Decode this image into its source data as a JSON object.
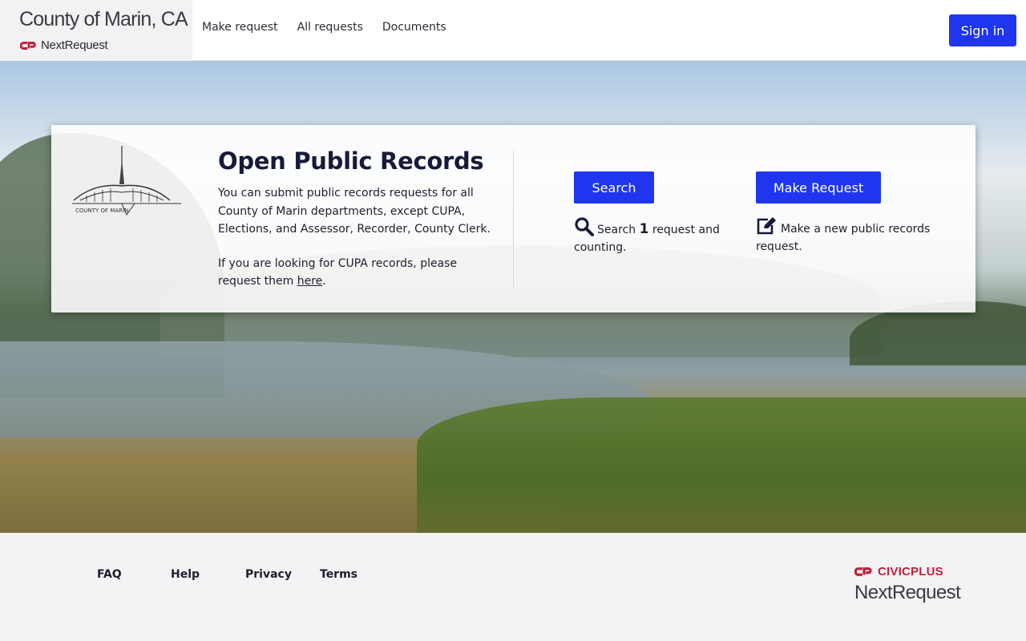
{
  "header": {
    "org_title": "County of Marin, CA",
    "product_name": "NextRequest",
    "nav": [
      "Make request",
      "All requests",
      "Documents"
    ],
    "sign_in_label": "Sign in"
  },
  "hero": {
    "logo_caption": "COUNTY OF MARIN",
    "title": "Open Public Records",
    "intro_1": "You can submit public records requests for all County of Marin departments, except CUPA, Elections, and Assessor, Recorder, County Clerk.",
    "intro_2_before": "If you are looking for CUPA records, please request them ",
    "intro_2_link": "here",
    "intro_2_after": ".",
    "search": {
      "button_label": "Search",
      "desc_before": "Search ",
      "count": "1",
      "desc_after": " request and counting."
    },
    "make_request": {
      "button_label": "Make Request",
      "desc": "Make a new public records request."
    }
  },
  "footer": {
    "links": [
      "FAQ",
      "Help",
      "Privacy",
      "Terms"
    ],
    "brand_company": "CIVICPLUS",
    "brand_product": "NextRequest"
  },
  "colors": {
    "primary_button": "#1f35f0",
    "brand_red": "#c2203a",
    "title_navy": "#161b3a"
  },
  "icons": {
    "search": "search-icon",
    "edit": "edit-icon",
    "brand_mark": "cp-logo-icon"
  }
}
